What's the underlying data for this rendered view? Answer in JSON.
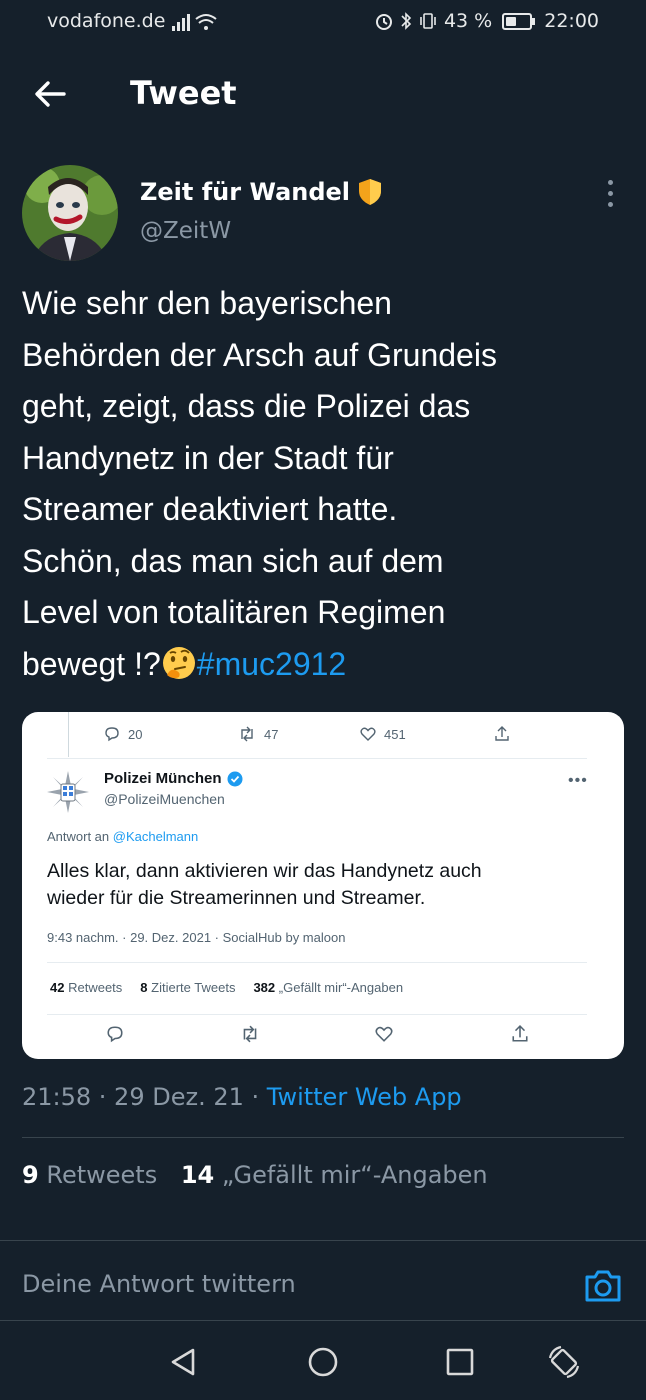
{
  "status_bar": {
    "carrier": "vodafone.de",
    "battery_text": "43 %",
    "battery_level": 0.43,
    "time": "22:00"
  },
  "header": {
    "title": "Tweet"
  },
  "tweet": {
    "author_name": "Zeit für Wandel",
    "handle": "@ZeitW",
    "text_lines": [
      "Wie sehr den bayerischen",
      "Behörden der Arsch auf Grundeis",
      "geht, zeigt, dass die Polizei das",
      "Handynetz in der Stadt für",
      "Streamer deaktiviert hatte.",
      "Schön, das man sich auf dem",
      "Level von totalitären Regimen"
    ],
    "text_last": "bewegt !?",
    "hashtag": "#muc2912",
    "timestamp": "21:58 · 29 Dez. 21 · ",
    "source_app": "Twitter Web App",
    "retweet_count": "9",
    "retweet_label": "Retweets",
    "like_count": "14",
    "like_label": "„Gefällt mir“-Angaben"
  },
  "embedded": {
    "top_actions": {
      "replies": "20",
      "retweets": "47",
      "likes": "451"
    },
    "name": "Polizei München",
    "handle": "@PolizeiMuenchen",
    "reply_prefix": "Antwort an ",
    "reply_mention": "@Kachelmann",
    "text_line1": "Alles klar, dann aktivieren wir das Handynetz auch",
    "text_line2": "wieder für die Streamerinnen und Streamer.",
    "time": "9:43 nachm. · 29. Dez. 2021 · SocialHub by maloon",
    "stats": {
      "retweets_count": "42",
      "retweets_label": "Retweets",
      "quotes_count": "8",
      "quotes_label": "Zitierte Tweets",
      "likes_count": "382",
      "likes_label": "„Gefällt mir“-Angaben"
    }
  },
  "reply_bar": {
    "placeholder": "Deine Antwort twittern"
  },
  "colors": {
    "background": "#15202b",
    "accent": "#1d9bf0",
    "secondary_text": "#8b98a5",
    "divider": "#38444d"
  }
}
